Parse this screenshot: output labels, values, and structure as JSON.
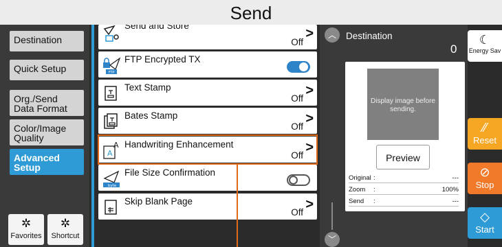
{
  "title": "Send",
  "left_menu": [
    {
      "label": "Destination",
      "active": false
    },
    {
      "label": "Quick Setup",
      "active": false
    },
    {
      "label": "Org./Send Data Format",
      "active": false
    },
    {
      "label": "Color/Image Quality",
      "active": false
    },
    {
      "label": "Advanced Setup",
      "active": true
    }
  ],
  "footer_buttons": {
    "favorites": "Favorites",
    "shortcut": "Shortcut"
  },
  "items": [
    {
      "label": "Send and Store",
      "value": "Off",
      "icon": "send-store-icon"
    },
    {
      "label": "FTP Encrypted TX",
      "value": "",
      "toggle": "on",
      "icon": "ftp-icon",
      "icon_text": "FTP"
    },
    {
      "label": "Text Stamp",
      "value": "Off",
      "icon": "text-stamp-icon"
    },
    {
      "label": "Bates Stamp",
      "value": "Off",
      "icon": "bates-stamp-icon"
    },
    {
      "label": "Handwriting Enhancement",
      "value": "Off",
      "icon": "handwriting-icon"
    },
    {
      "label": "File Size Confirmation",
      "value": "",
      "toggle": "off",
      "icon": "file-size-icon",
      "icon_text": "byte"
    },
    {
      "label": "Skip Blank Page",
      "value": "Off",
      "icon": "skip-blank-icon"
    }
  ],
  "destination": {
    "label": "Destination",
    "count": "0"
  },
  "preview": {
    "thumb_text": "Display image before sending.",
    "button": "Preview",
    "rows": [
      {
        "key": "Original",
        "colon": ":",
        "value": "---"
      },
      {
        "key": "Zoom",
        "colon": ":",
        "value": "100%"
      },
      {
        "key": "Send",
        "colon": ":",
        "value": "---"
      }
    ]
  },
  "right_buttons": {
    "energy": "Energy Sav",
    "reset": "Reset",
    "stop": "Stop",
    "start": "Start"
  },
  "colors": {
    "accent": "#2e9bd6",
    "highlight": "#e06a1a",
    "reset": "#f5a623",
    "stop": "#f07a2a",
    "start": "#2e9bd6"
  }
}
